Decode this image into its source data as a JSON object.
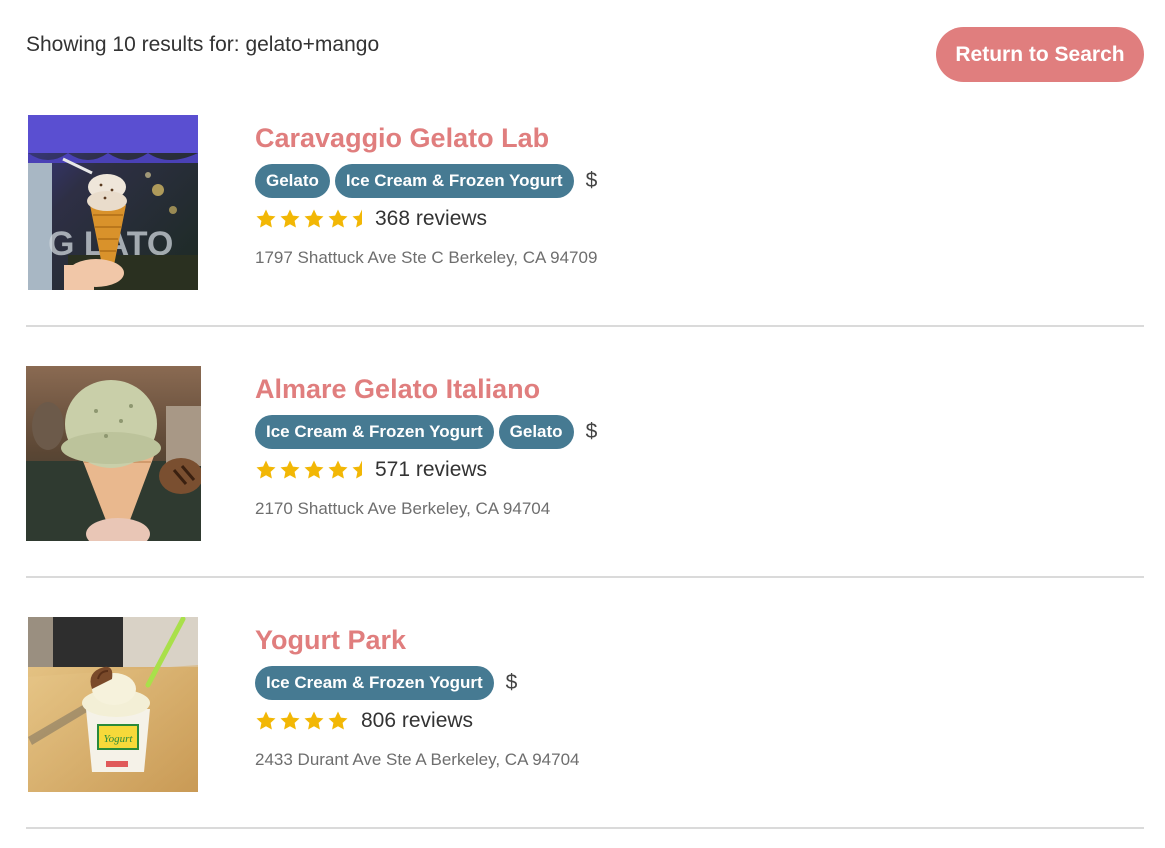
{
  "header": {
    "results_text": "Showing 10 results for: gelato+mango",
    "return_button_label": "Return to Search"
  },
  "colors": {
    "accent": "#e07e7e",
    "tag_bg": "#467a92",
    "star": "#f2b705",
    "divider": "#dadada"
  },
  "results": [
    {
      "name": "Caravaggio Gelato Lab",
      "tags": [
        "Gelato",
        "Ice Cream & Frozen Yogurt"
      ],
      "price": "$",
      "rating": 4.5,
      "reviews": "368 reviews",
      "address": "1797 Shattuck Ave Ste C Berkeley, CA 94709",
      "image_icon": "gelato-cone-photo"
    },
    {
      "name": "Almare Gelato Italiano",
      "tags": [
        "Ice Cream & Frozen Yogurt",
        "Gelato"
      ],
      "price": "$",
      "rating": 4.5,
      "reviews": "571 reviews",
      "address": "2170 Shattuck Ave Berkeley, CA 94704",
      "image_icon": "gelato-scoop-photo"
    },
    {
      "name": "Yogurt Park",
      "tags": [
        "Ice Cream & Frozen Yogurt"
      ],
      "price": "$",
      "rating": 4,
      "reviews": "806 reviews",
      "address": "2433 Durant Ave Ste A Berkeley, CA 94704",
      "image_icon": "frozen-yogurt-cup-photo"
    }
  ]
}
